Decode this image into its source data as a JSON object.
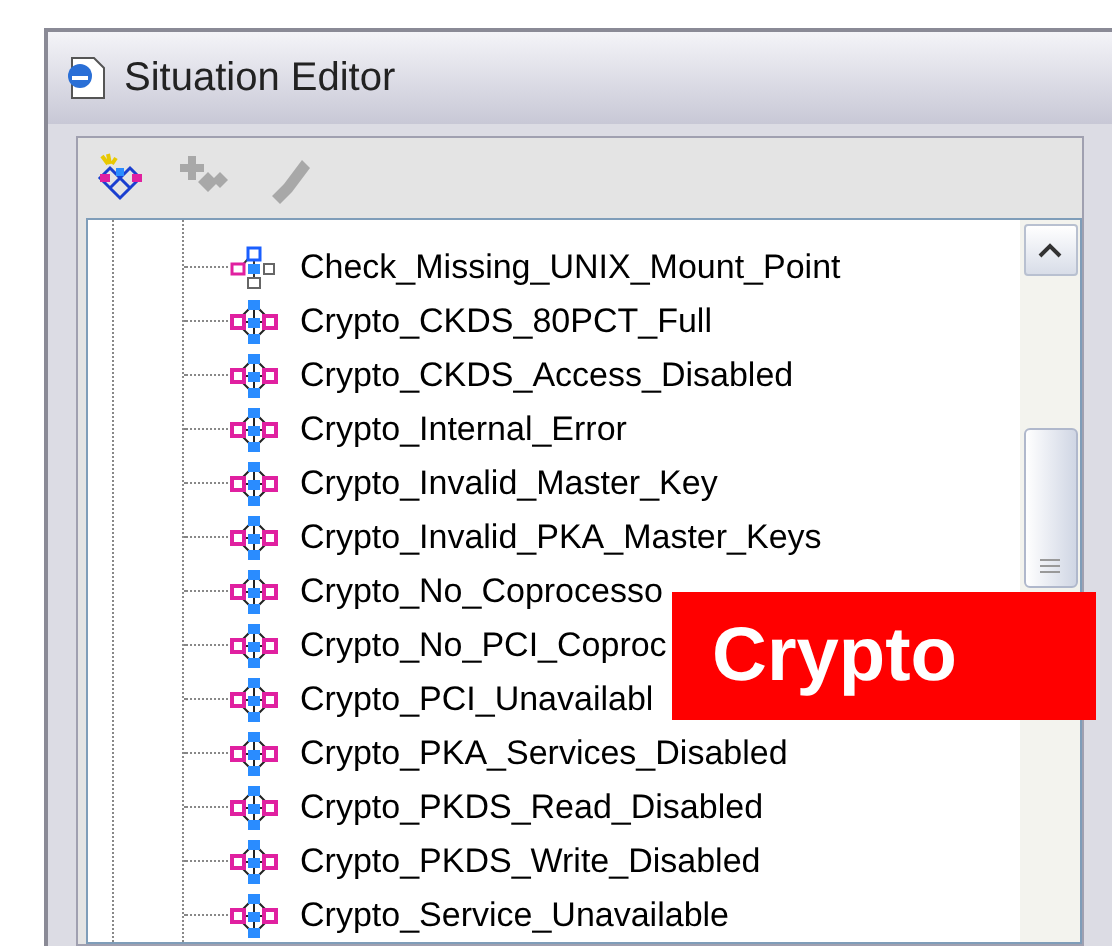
{
  "window": {
    "title": "Situation Editor"
  },
  "toolbar": [
    {
      "kind": "new",
      "disabled": false
    },
    {
      "kind": "add",
      "disabled": true
    },
    {
      "kind": "edit",
      "disabled": true
    }
  ],
  "tree": {
    "items": [
      {
        "label": "Check_Missing_UNIX_Mount_Point",
        "kind": "branch"
      },
      {
        "label": "Crypto_CKDS_80PCT_Full",
        "kind": "diamond"
      },
      {
        "label": "Crypto_CKDS_Access_Disabled",
        "kind": "diamond"
      },
      {
        "label": "Crypto_Internal_Error",
        "kind": "diamond"
      },
      {
        "label": "Crypto_Invalid_Master_Key",
        "kind": "diamond"
      },
      {
        "label": "Crypto_Invalid_PKA_Master_Keys",
        "kind": "diamond"
      },
      {
        "label": "Crypto_No_Coprocesso",
        "kind": "diamond"
      },
      {
        "label": "Crypto_No_PCI_Coproc",
        "kind": "diamond"
      },
      {
        "label": "Crypto_PCI_Unavailabl",
        "kind": "diamond"
      },
      {
        "label": "Crypto_PKA_Services_Disabled",
        "kind": "diamond"
      },
      {
        "label": "Crypto_PKDS_Read_Disabled",
        "kind": "diamond"
      },
      {
        "label": "Crypto_PKDS_Write_Disabled",
        "kind": "diamond"
      },
      {
        "label": "Crypto_Service_Unavailable",
        "kind": "diamond"
      }
    ]
  },
  "callout": {
    "text": "Crypto"
  }
}
